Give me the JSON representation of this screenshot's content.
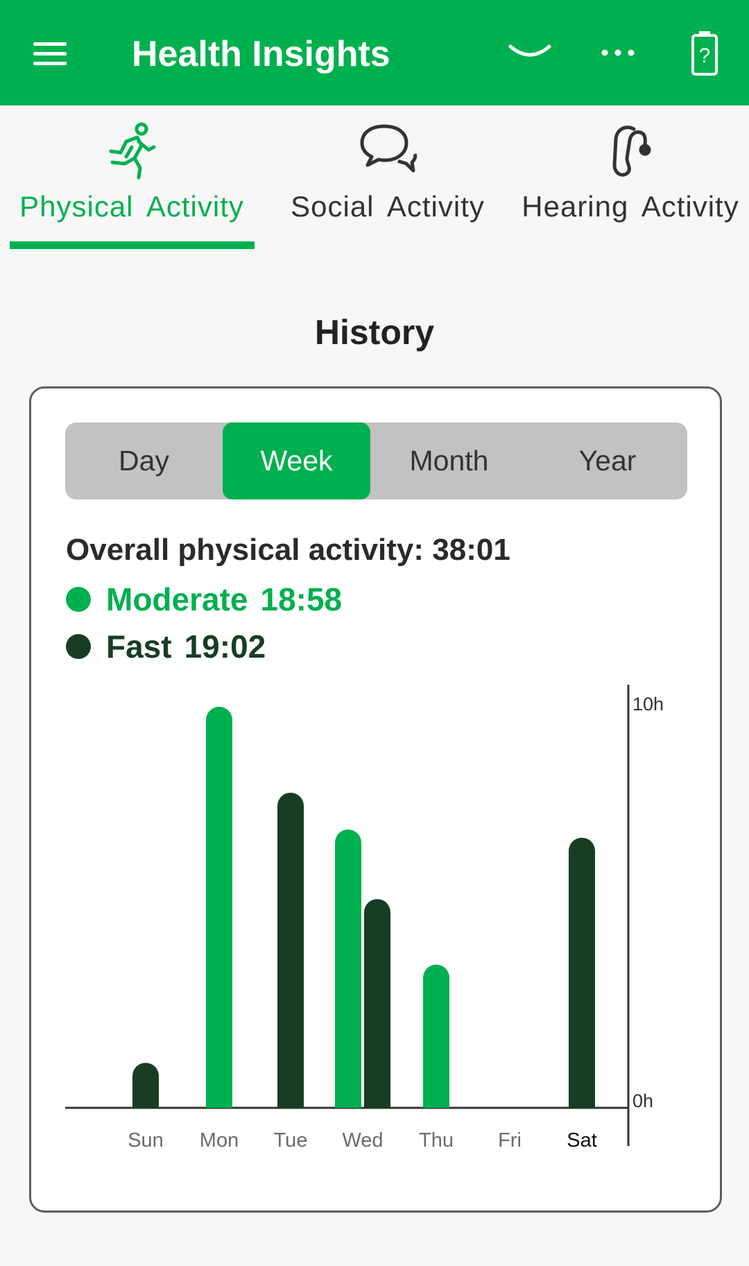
{
  "header": {
    "title": "Health Insights",
    "icons": [
      "menu-icon",
      "chevron-down-icon",
      "more-icon",
      "battery-help-icon"
    ]
  },
  "tabs": [
    {
      "label": "Physical  Activity",
      "icon": "running-person-icon",
      "active": true
    },
    {
      "label": "Social  Activity",
      "icon": "chat-bubbles-icon",
      "active": false
    },
    {
      "label": "Hearing  Activity",
      "icon": "hearing-aid-icon",
      "active": false
    }
  ],
  "section_title": "History",
  "periods": {
    "options": [
      "Day",
      "Week",
      "Month",
      "Year"
    ],
    "selected": "Week"
  },
  "summary": {
    "overall_label": "Overall physical activity: 38:01",
    "moderate_label": "Moderate",
    "moderate_value": "18:58",
    "fast_label": "Fast",
    "fast_value": "19:02"
  },
  "colors": {
    "accent": "#00b04f",
    "moderate": "#00b04f",
    "fast": "#173d23"
  },
  "chart_data": {
    "type": "bar",
    "categories": [
      "Sun",
      "Mon",
      "Tue",
      "Wed",
      "Thu",
      "Fri",
      "Sat"
    ],
    "highlighted_category": "Sat",
    "series": [
      {
        "name": "Moderate",
        "values": [
          0,
          9.8,
          0,
          6.8,
          3.5,
          0,
          0
        ]
      },
      {
        "name": "Fast",
        "values": [
          1.1,
          0,
          7.7,
          5.1,
          0,
          0,
          6.6
        ]
      }
    ],
    "ylim": [
      0,
      10
    ],
    "y_ticks": [
      "10h",
      "0h"
    ],
    "y_axis_side": "right"
  }
}
